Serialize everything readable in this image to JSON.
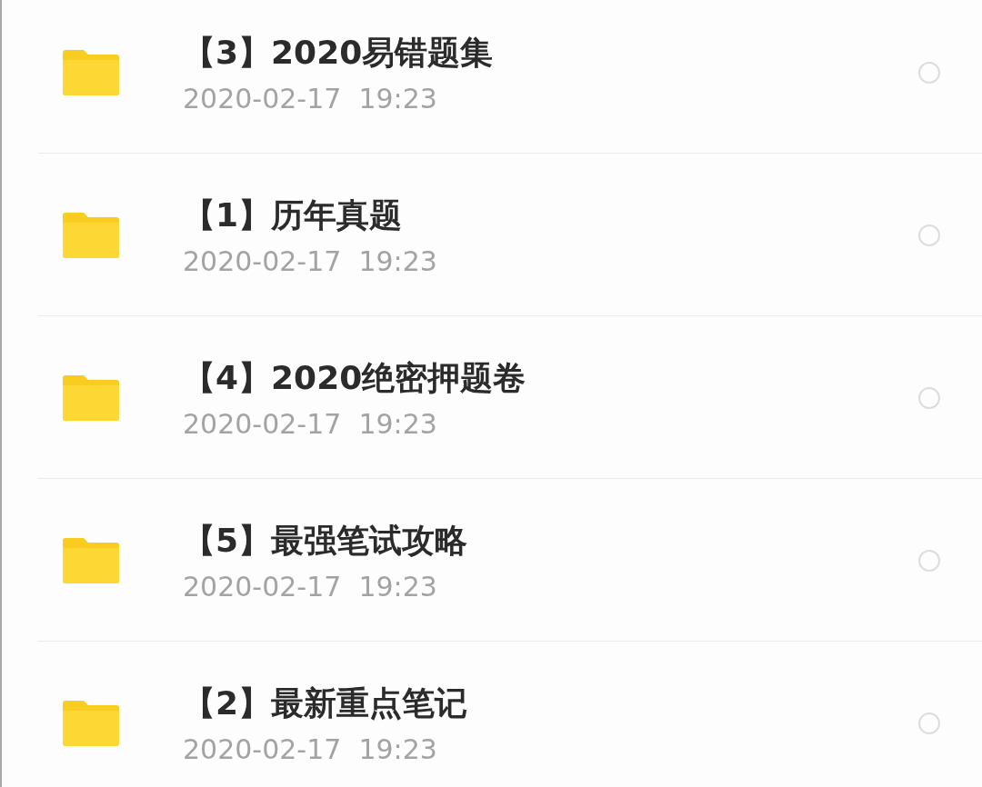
{
  "files": [
    {
      "name": "【3】2020易错题集",
      "date": "2020-02-17  19:23",
      "selected": false
    },
    {
      "name": "【1】历年真题",
      "date": "2020-02-17  19:23",
      "selected": false
    },
    {
      "name": "【4】2020绝密押题卷",
      "date": "2020-02-17  19:23",
      "selected": false
    },
    {
      "name": "【5】最强笔试攻略",
      "date": "2020-02-17  19:23",
      "selected": false
    },
    {
      "name": "【2】最新重点笔记",
      "date": "2020-02-17  19:23",
      "selected": false
    }
  ]
}
